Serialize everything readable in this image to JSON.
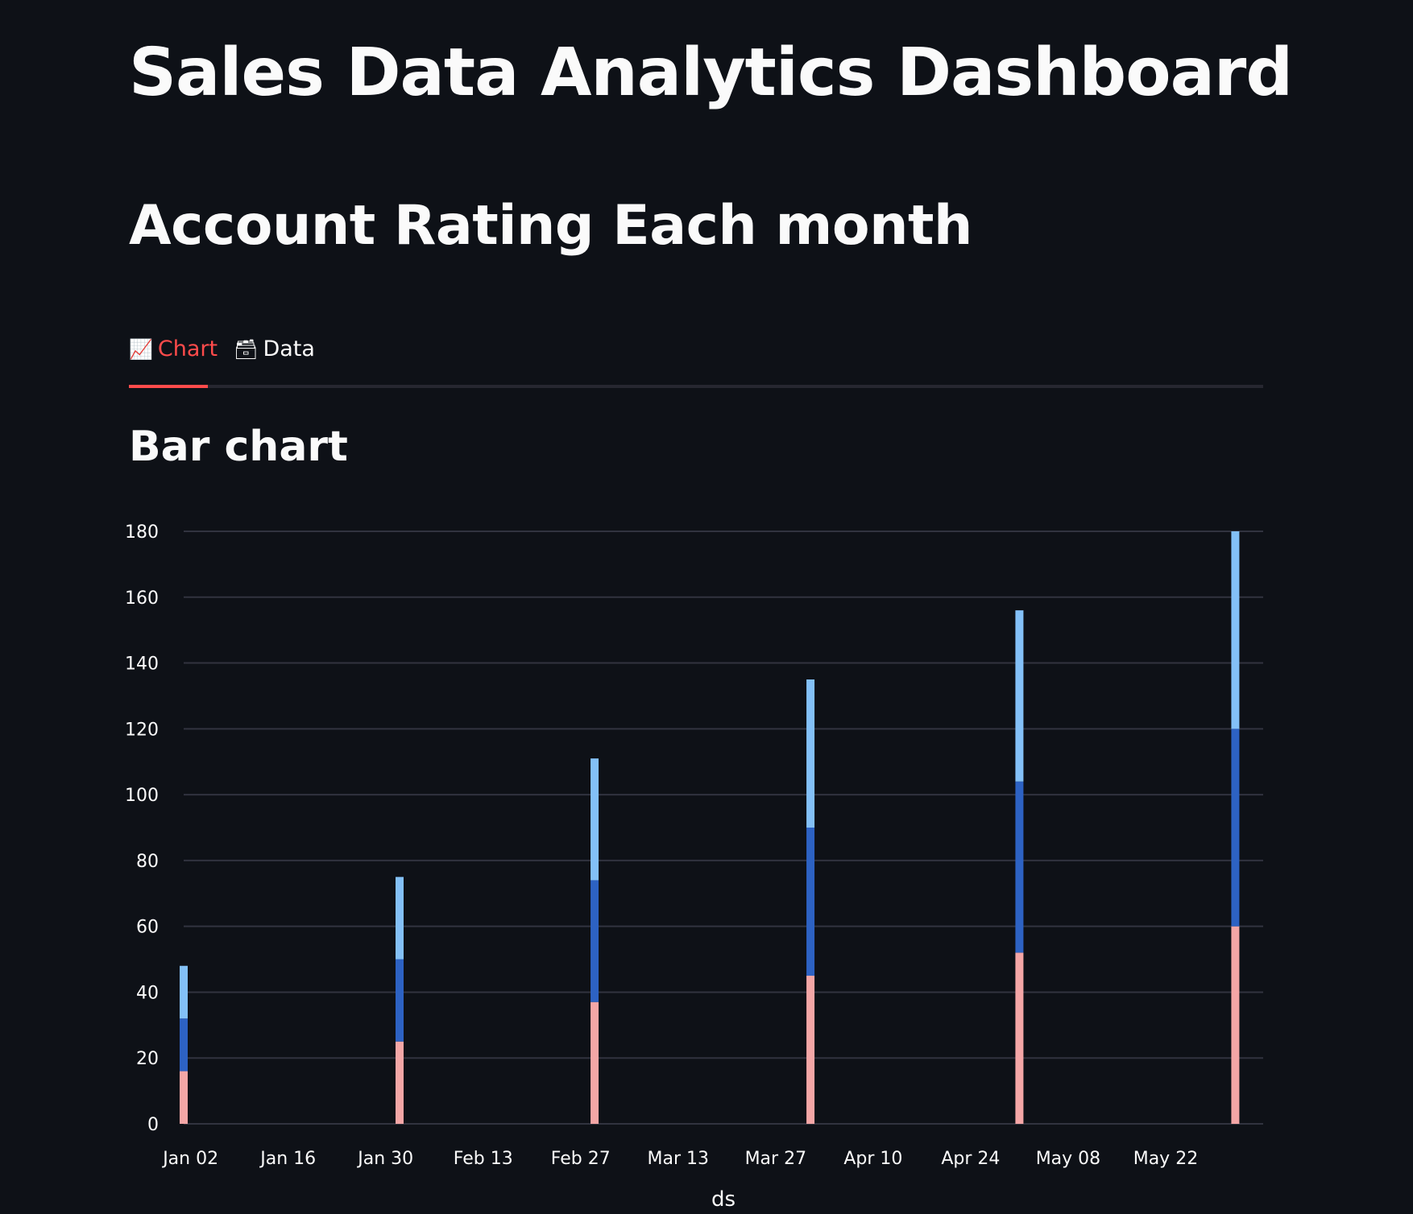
{
  "header": {
    "title": "Sales Data Analytics Dashboard",
    "section_title": "Account Rating Each month"
  },
  "tabs": [
    {
      "label": "Chart",
      "icon": "chart-increasing-icon",
      "active": true
    },
    {
      "label": "Data",
      "icon": "card-file-icon",
      "active": false
    }
  ],
  "chart_title": "Bar chart",
  "colors": {
    "background": "#0e1117",
    "accent": "#ff4b4b",
    "series_low": "#f4a6a6",
    "series_mid": "#2d62c3",
    "series_high": "#83c0f7",
    "grid": "#31333f"
  },
  "chart_data": {
    "type": "bar",
    "stacked": true,
    "xlabel": "ds",
    "ylabel": "",
    "ylim": [
      0,
      180
    ],
    "yticks": [
      0,
      20,
      40,
      60,
      80,
      100,
      120,
      140,
      160,
      180
    ],
    "xlim": [
      "2023-01-01",
      "2023-06-05"
    ],
    "xtick_labels": [
      "Jan 02",
      "Jan 16",
      "Jan 30",
      "Feb 13",
      "Feb 27",
      "Mar 13",
      "Mar 27",
      "Apr 10",
      "Apr 24",
      "May 08",
      "May 22"
    ],
    "xtick_dates": [
      "2023-01-02",
      "2023-01-16",
      "2023-01-30",
      "2023-02-13",
      "2023-02-27",
      "2023-03-13",
      "2023-03-27",
      "2023-04-10",
      "2023-04-24",
      "2023-05-08",
      "2023-05-22"
    ],
    "x": [
      "2023-01-01",
      "2023-02-01",
      "2023-03-01",
      "2023-04-01",
      "2023-05-01",
      "2023-06-01"
    ],
    "series": [
      {
        "values": [
          16,
          25,
          37,
          45,
          52,
          60
        ],
        "color": "#f4a6a6"
      },
      {
        "values": [
          16,
          25,
          37,
          45,
          52,
          60
        ],
        "color": "#2d62c3"
      },
      {
        "values": [
          16,
          25,
          37,
          45,
          52,
          60
        ],
        "color": "#83c0f7"
      }
    ],
    "grid": true,
    "legend": "none"
  }
}
